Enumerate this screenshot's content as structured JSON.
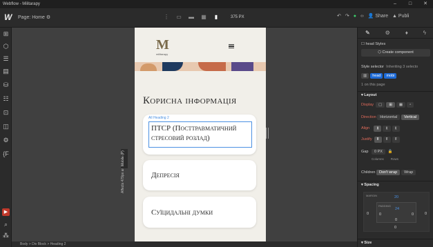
{
  "window": {
    "title": "Webflow - Militarapy",
    "controls": [
      "min",
      "max",
      "close"
    ]
  },
  "topbar": {
    "logo": "W",
    "page_label": "Page: Home",
    "width_label": "375 PX",
    "share": "Share",
    "publish": "Publi"
  },
  "canvas": {
    "logo_letter": "M",
    "logo_sub": "militarapy",
    "heading": "Корисна інформація",
    "selection_tag": "All Heading 2",
    "card1": "ПТСР (Посттравматичний стресовий розлад)",
    "card2": "Депресія",
    "card3": "Суїцидальні думки",
    "side_note": "Affects 479px and below",
    "mobile_tag": "Mobile (P)"
  },
  "breadcrumb": "Body > Div Block > Heading 2",
  "panel": {
    "head_styles": "head Styles",
    "create_component": "Create component",
    "style_selector": "Style selector",
    "inheriting": "Inheriting 3 selecto",
    "class1": "head",
    "class2": "mobi",
    "on_this_page": "1 on this page",
    "layout": "Layout",
    "display": "Display",
    "direction": "Direction",
    "horizontal": "Horizontal",
    "vertical": "Vertical",
    "align": "Align",
    "justify": "Justify",
    "gap": "Gap",
    "gap_value": "0",
    "gap_unit": "PX",
    "columns": "Columns",
    "rows": "Rows",
    "children": "Children",
    "dont_wrap": "Don't wrap",
    "wrap": "Wrap",
    "spacing": "Spacing",
    "margin": "MARGIN",
    "margin_top": "20",
    "padding": "PADDING",
    "padding_top": "24",
    "zero": "0",
    "size": "Size"
  }
}
